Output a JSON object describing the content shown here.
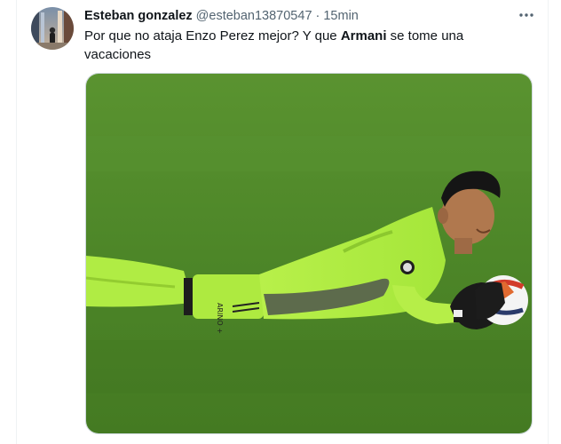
{
  "tweet": {
    "author_name": "Esteban gonzalez",
    "handle": "@esteban13870547",
    "separator": "·",
    "time": "15min",
    "text_part1": "Por que no ataja Enzo Perez mejor? Y que ",
    "text_bold": "Armani",
    "text_part2": " se tome una vacaciones",
    "more_icon": "more-horizontal-icon",
    "media_label": "image"
  },
  "colors": {
    "text_primary": "#0f1419",
    "text_secondary": "#536471",
    "pitch_green": "#4f8a2b",
    "kit_green": "#a8ec3a",
    "border": "#cfd9de"
  }
}
